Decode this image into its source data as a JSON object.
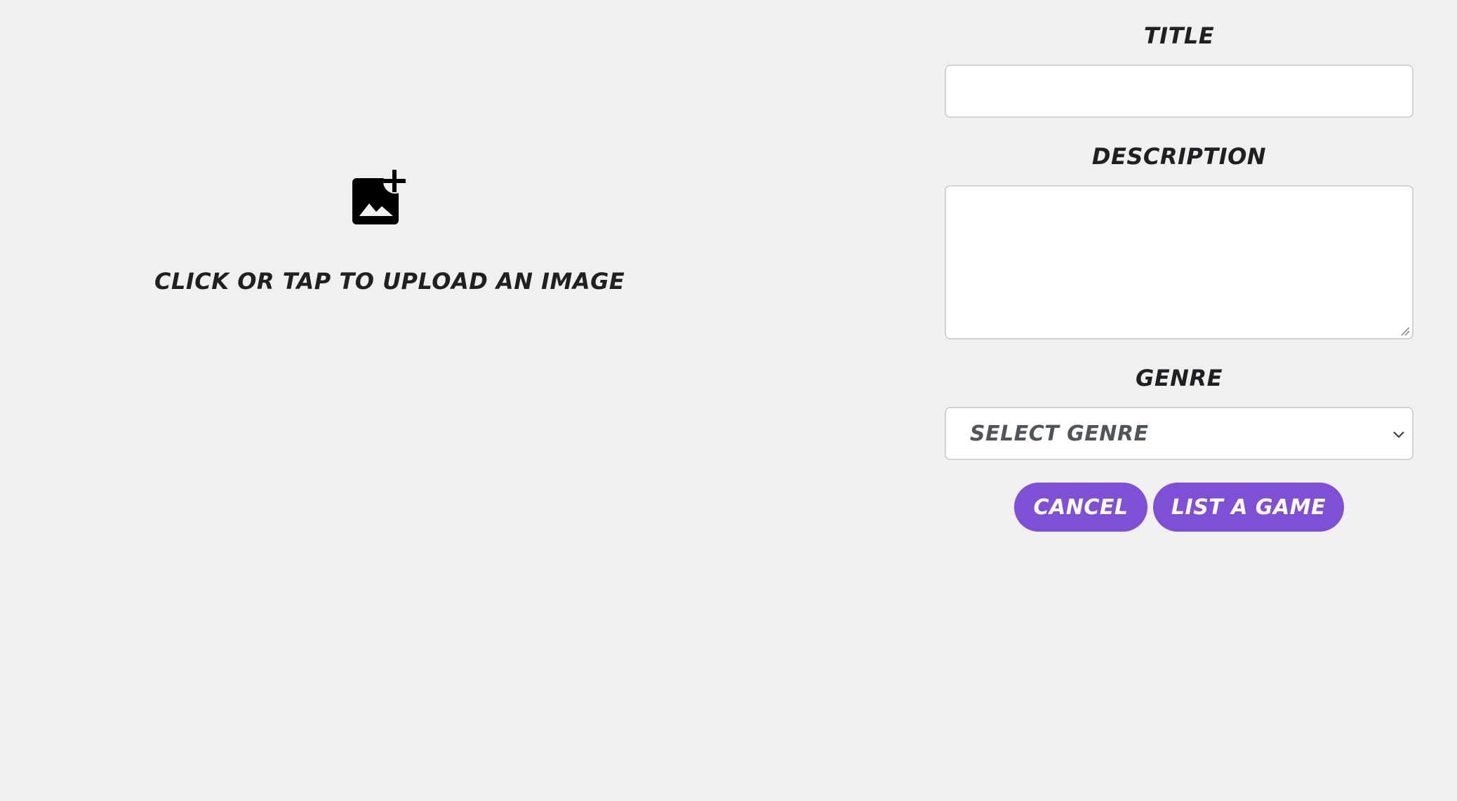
{
  "upload": {
    "icon": "add-photo-icon",
    "text": "CLICK OR TAP TO UPLOAD AN IMAGE"
  },
  "form": {
    "title_label": "TITLE",
    "title_value": "",
    "description_label": "DESCRIPTION",
    "description_value": "",
    "genre_label": "GENRE",
    "genre_selected": "SELECT GENRE",
    "cancel_label": "CANCEL",
    "submit_label": "LIST A GAME"
  },
  "colors": {
    "background": "#f0f0f0",
    "accent": "#7f4fd6",
    "text": "#1f1f24",
    "field_border": "#cfd3d8"
  }
}
